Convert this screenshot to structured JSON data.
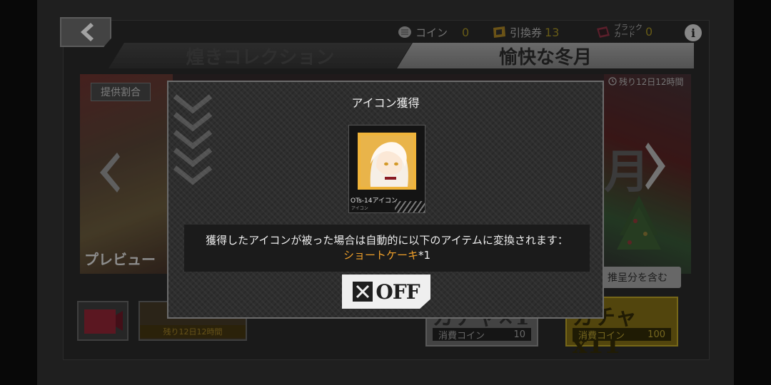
{
  "header": {
    "currencies": [
      {
        "label": "コイン",
        "value": "0",
        "icon": "coin-icon"
      },
      {
        "label": "引換券",
        "value": "13",
        "icon": "ticket-icon"
      },
      {
        "label": "ブラック\nカード",
        "value": "0",
        "icon": "black-card-icon"
      }
    ],
    "info_label": "i"
  },
  "tabs": [
    {
      "label": "煌きコレクション",
      "active": false
    },
    {
      "label": "愉快な冬月",
      "active": true
    }
  ],
  "banner": {
    "rate_label": "提供割合",
    "remaining_time": "残り12日12時間",
    "preview_label": "プレビュー",
    "bg_moon_text": "月",
    "note": "推呈分を含む"
  },
  "bottom": {
    "timer": "残り12日12時間"
  },
  "gacha_buttons": [
    {
      "title": "ガチャ×1",
      "cost_label": "消費コイン",
      "cost": "10"
    },
    {
      "title": "ガチャ",
      "multiplier": "x11",
      "cost_label": "消費コイン",
      "cost": "100"
    }
  ],
  "modal": {
    "title": "アイコン獲得",
    "card": {
      "name": "OTs-14アイコン",
      "sub": "アイコン"
    },
    "message": "獲得したアイコンが被った場合は自動的に以下のアイテムに変換されます：",
    "item_name": "ショートケーキ",
    "item_mult": "*1",
    "off_button": {
      "icon": "x-box-icon",
      "label": "OFF"
    }
  },
  "colors": {
    "accent_orange": "#f0a02a",
    "gold": "#f0b43a",
    "panel_bg": "#2e2e2e"
  }
}
